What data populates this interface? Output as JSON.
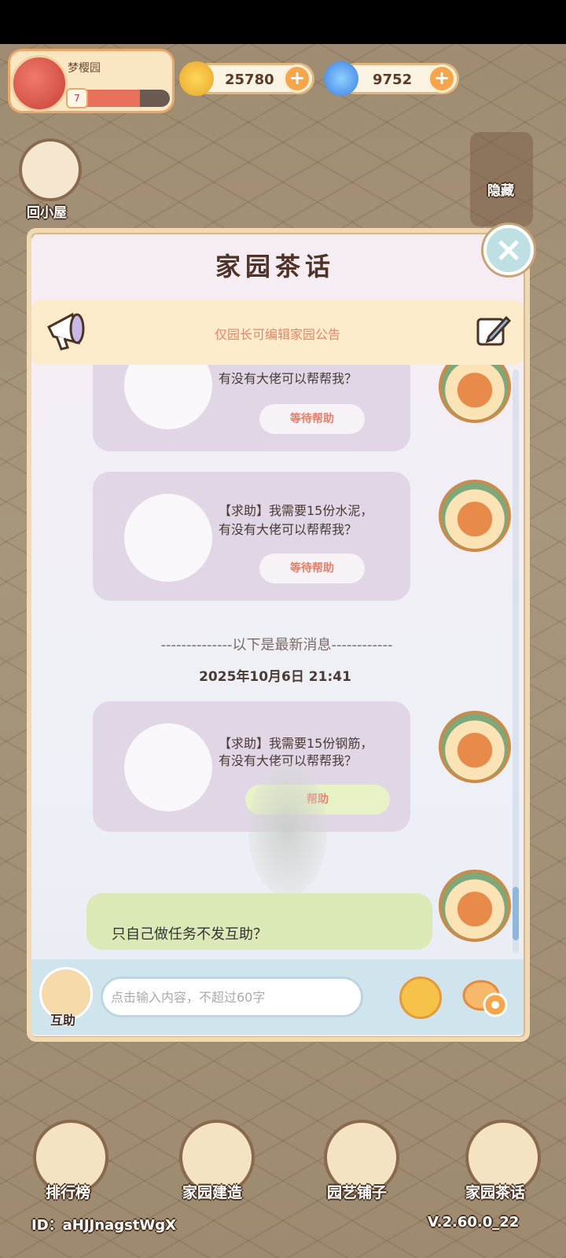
{
  "hud": {
    "garden_name": "梦樱园",
    "level": "7",
    "level_progress": 0.7,
    "coins": "25780",
    "gems": "9752",
    "plus": "+"
  },
  "side": {
    "home_label": "回小屋",
    "hide_label": "隐藏"
  },
  "modal": {
    "title": "家园茶话",
    "close": "×",
    "announcement": "仅园长可编辑家园公告"
  },
  "messages": [
    {
      "line1": "有没有大佬可以帮帮我？",
      "button": "等待帮助",
      "item_icon": "wood-logs-icon"
    },
    {
      "line1": "【求助】我需要15份水泥，",
      "line2": "有没有大佬可以帮帮我？",
      "button": "等待帮助",
      "item_icon": "cement-bags-icon"
    },
    {
      "line1": "【求助】我需要15份钢筋，",
      "line2": "有没有大佬可以帮帮我？",
      "button": "帮助",
      "item_icon": "steel-bars-icon"
    }
  ],
  "divider": "--------------以下是最新消息------------",
  "timestamp": "2025年10月6日 21:41",
  "user_message": "只自己做任务不发互助？",
  "input": {
    "assist_label": "互助",
    "placeholder": "点击输入内容，不超过60字"
  },
  "nav": [
    {
      "label": "排行榜",
      "icon": "leaderboard-icon"
    },
    {
      "label": "家园建造",
      "icon": "build-bricks-icon"
    },
    {
      "label": "园艺铺子",
      "icon": "garden-shop-icon"
    },
    {
      "label": "家园茶话",
      "icon": "chat-bubbles-icon"
    }
  ],
  "footer": {
    "id": "ID：aHJJnagstWgX",
    "version": "V.2.60.0_22"
  },
  "colors": {
    "accent_orange": "#f6a54a",
    "bubble_purple": "#e0d6e6",
    "bubble_green": "#dbe9b6",
    "wait_text": "#e3806a"
  }
}
